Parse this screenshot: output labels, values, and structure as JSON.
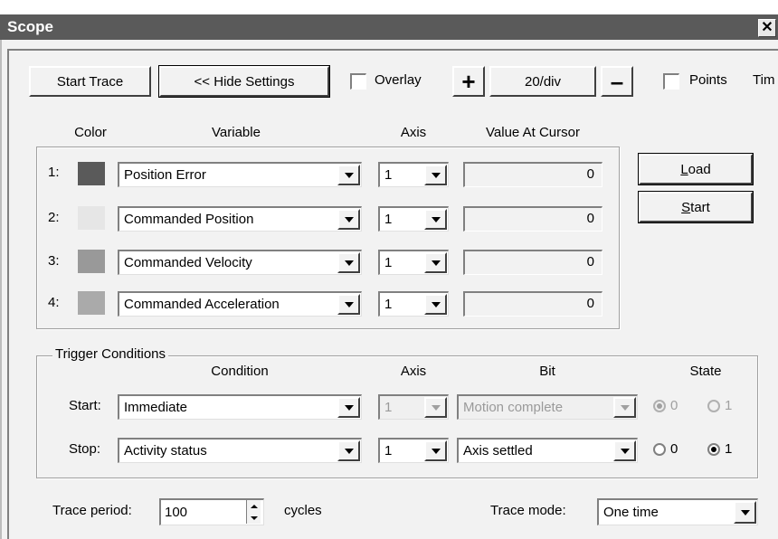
{
  "window": {
    "title": "Scope"
  },
  "toolbar": {
    "start_trace": "Start Trace",
    "hide_settings": "<< Hide Settings",
    "overlay_label": "Overlay",
    "plus": "+",
    "scale": "20/div",
    "minus": "–",
    "points_label": "Points",
    "time_label": "Tim"
  },
  "variables": {
    "headers": {
      "color": "Color",
      "variable": "Variable",
      "axis": "Axis",
      "value": "Value At Cursor"
    },
    "rows": [
      {
        "index": "1:",
        "color": "#5a5a5a",
        "variable": "Position Error",
        "axis": "1",
        "value": "0"
      },
      {
        "index": "2:",
        "color": "#e6e6e6",
        "variable": "Commanded Position",
        "axis": "1",
        "value": "0"
      },
      {
        "index": "3:",
        "color": "#999999",
        "variable": "Commanded Velocity",
        "axis": "1",
        "value": "0"
      },
      {
        "index": "4:",
        "color": "#aaaaaa",
        "variable": "Commanded Acceleration",
        "axis": "1",
        "value": "0"
      }
    ],
    "load_label": "Load",
    "start_label": "Start"
  },
  "trigger": {
    "title": "Trigger Conditions",
    "headers": {
      "condition": "Condition",
      "axis": "Axis",
      "bit": "Bit",
      "state": "State"
    },
    "start": {
      "label": "Start:",
      "condition": "Immediate",
      "axis": "1",
      "bit": "Motion complete",
      "state0": "0",
      "state1": "1",
      "selected": "0"
    },
    "stop": {
      "label": "Stop:",
      "condition": "Activity status",
      "axis": "1",
      "bit": "Axis settled",
      "state0": "0",
      "state1": "1",
      "selected": "1"
    }
  },
  "footer": {
    "period_label": "Trace period:",
    "period_value": "100",
    "period_unit": "cycles",
    "mode_label": "Trace mode:",
    "mode_value": "One time"
  }
}
